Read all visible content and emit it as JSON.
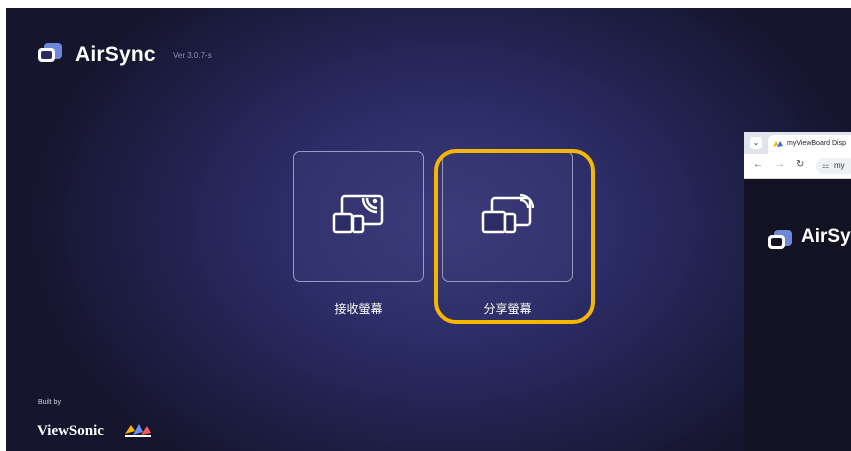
{
  "app": {
    "title": "AirSync",
    "version": "Ver 3.0.7-s",
    "logo_icon": "cast-window-icon"
  },
  "tiles": [
    {
      "label": "接收螢幕",
      "icon": "receive-screen-icon"
    },
    {
      "label": "分享螢幕",
      "icon": "share-screen-icon"
    }
  ],
  "footer": {
    "built_by": "Built by",
    "brand": "ViewSonic",
    "brand_icon": "viewsonic-birds-icon"
  },
  "browser": {
    "tab_title": "myViewBoard Disp",
    "address": "my",
    "page_title": "AirSy"
  },
  "colors": {
    "highlight": "#f5b700",
    "background": "#2a2a63"
  }
}
